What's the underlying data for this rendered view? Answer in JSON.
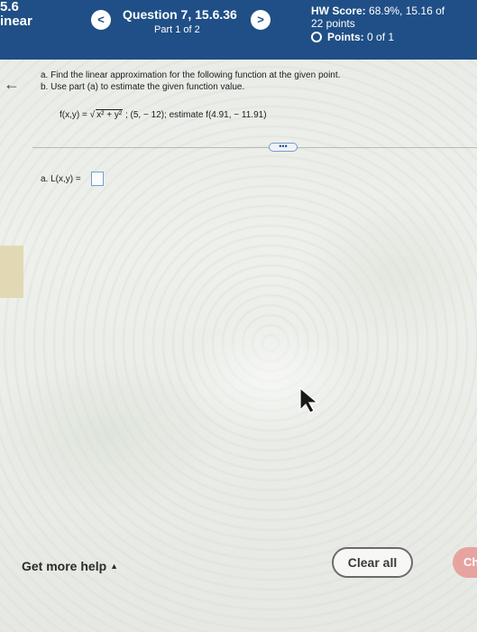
{
  "header": {
    "section_number": "5.6",
    "section_name": "inear",
    "prev_glyph": "<",
    "next_glyph": ">",
    "question_title": "Question 7, 15.6.36",
    "question_part": "Part 1 of 2",
    "hw_score_label": "HW Score:",
    "hw_score_value": "68.9%, 15.16 of",
    "hw_score_total": "22 points",
    "points_label": "Points:",
    "points_value": "0 of 1",
    "bar_color": "#1f4f86"
  },
  "side": {
    "back_glyph": "←"
  },
  "question": {
    "line_a": "a. Find the linear approximation for the following function at the given point.",
    "line_b": "b. Use part (a) to estimate the given function value.",
    "formula_prefix": "f(x,y) =",
    "formula_radicand": "x² + y²",
    "formula_rest": "; (5, − 12); estimate f(4.91, − 11.91)",
    "more_glyph": "•••",
    "answer_label": "a. L(x,y) ="
  },
  "footer": {
    "help_label": "Get more help",
    "help_caret": "▲",
    "clear_label": "Clear all",
    "check_label": "Ch"
  },
  "icons": {
    "back": "arrow-left-icon",
    "prev": "chevron-left-icon",
    "next": "chevron-right-icon",
    "cursor": "mouse-pointer-icon"
  }
}
